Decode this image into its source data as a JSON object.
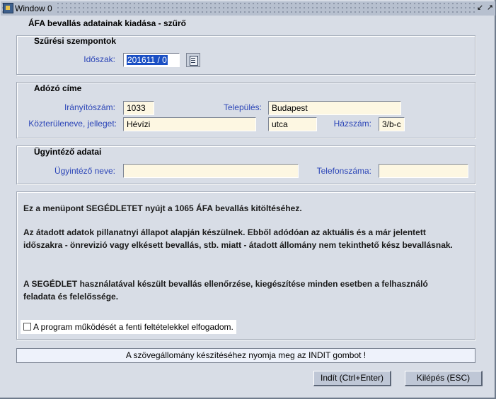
{
  "window": {
    "title": "Window 0",
    "heading": "ÁFA bevallás adatainak kiadása -  szűrő"
  },
  "filter": {
    "group_title": "Szűrési szempontok",
    "period_label": "Időszak:",
    "period_value": "201611 / 0"
  },
  "address": {
    "group_title": "Adózó címe",
    "zip_label": "Irányítószám:",
    "zip_value": "1033",
    "city_label": "Település:",
    "city_value": "Budapest",
    "street_label": "Közterüleneve, jelleget:",
    "street_value": "Hévízi",
    "street_type": "utca",
    "house_label": "Házszám:",
    "house_value": "3/b-c"
  },
  "agent": {
    "group_title": "Ügyintéző adatai",
    "name_label": "Ügyintéző neve:",
    "name_value": "",
    "phone_label": "Telefonszáma:",
    "phone_value": ""
  },
  "info": {
    "p1": "Ez a menüpont SEGÉDLETET nyújt a 1065 ÁFA bevallás kitöltéséhez.",
    "p2": "Az átadott adatok pillanatnyi állapot alapján készülnek. Ebből adódóan az aktuális és a már jelentett időszakra - önrevizió vagy elkésett bevallás, stb. miatt - átadott állomány nem tekinthető kész bevallásnak.",
    "p3": "A SEGÉDLET használatával készült bevallás ellenőrzése, kiegészítése minden esetben a felhasználó feladata és felelőssége.",
    "accept_label": "A program működését a fenti feltételekkel elfogadom.",
    "accept_checked": false
  },
  "message": "A szövegállomány készítéséhez nyomja meg az INDIT gombot !",
  "buttons": {
    "start": "Indít (Ctrl+Enter)",
    "exit": "Kilépés (ESC)"
  },
  "icons": {
    "app": "oracle-forms-app-icon",
    "lov": "list-of-values-icon",
    "minimize": "minimize-icon",
    "maximize": "maximize-icon"
  }
}
